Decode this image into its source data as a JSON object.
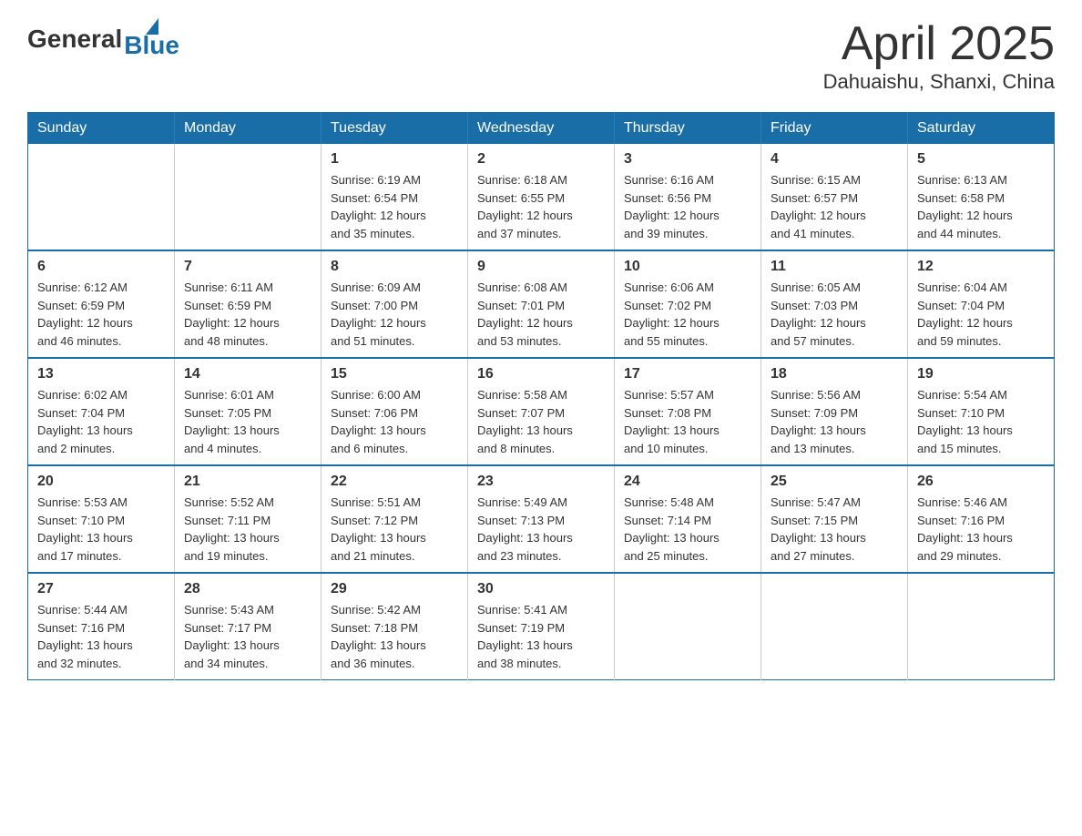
{
  "header": {
    "logo_general": "General",
    "logo_blue": "Blue",
    "month_title": "April 2025",
    "subtitle": "Dahuaishu, Shanxi, China"
  },
  "weekdays": [
    "Sunday",
    "Monday",
    "Tuesday",
    "Wednesday",
    "Thursday",
    "Friday",
    "Saturday"
  ],
  "weeks": [
    [
      {
        "day": "",
        "info": ""
      },
      {
        "day": "",
        "info": ""
      },
      {
        "day": "1",
        "info": "Sunrise: 6:19 AM\nSunset: 6:54 PM\nDaylight: 12 hours\nand 35 minutes."
      },
      {
        "day": "2",
        "info": "Sunrise: 6:18 AM\nSunset: 6:55 PM\nDaylight: 12 hours\nand 37 minutes."
      },
      {
        "day": "3",
        "info": "Sunrise: 6:16 AM\nSunset: 6:56 PM\nDaylight: 12 hours\nand 39 minutes."
      },
      {
        "day": "4",
        "info": "Sunrise: 6:15 AM\nSunset: 6:57 PM\nDaylight: 12 hours\nand 41 minutes."
      },
      {
        "day": "5",
        "info": "Sunrise: 6:13 AM\nSunset: 6:58 PM\nDaylight: 12 hours\nand 44 minutes."
      }
    ],
    [
      {
        "day": "6",
        "info": "Sunrise: 6:12 AM\nSunset: 6:59 PM\nDaylight: 12 hours\nand 46 minutes."
      },
      {
        "day": "7",
        "info": "Sunrise: 6:11 AM\nSunset: 6:59 PM\nDaylight: 12 hours\nand 48 minutes."
      },
      {
        "day": "8",
        "info": "Sunrise: 6:09 AM\nSunset: 7:00 PM\nDaylight: 12 hours\nand 51 minutes."
      },
      {
        "day": "9",
        "info": "Sunrise: 6:08 AM\nSunset: 7:01 PM\nDaylight: 12 hours\nand 53 minutes."
      },
      {
        "day": "10",
        "info": "Sunrise: 6:06 AM\nSunset: 7:02 PM\nDaylight: 12 hours\nand 55 minutes."
      },
      {
        "day": "11",
        "info": "Sunrise: 6:05 AM\nSunset: 7:03 PM\nDaylight: 12 hours\nand 57 minutes."
      },
      {
        "day": "12",
        "info": "Sunrise: 6:04 AM\nSunset: 7:04 PM\nDaylight: 12 hours\nand 59 minutes."
      }
    ],
    [
      {
        "day": "13",
        "info": "Sunrise: 6:02 AM\nSunset: 7:04 PM\nDaylight: 13 hours\nand 2 minutes."
      },
      {
        "day": "14",
        "info": "Sunrise: 6:01 AM\nSunset: 7:05 PM\nDaylight: 13 hours\nand 4 minutes."
      },
      {
        "day": "15",
        "info": "Sunrise: 6:00 AM\nSunset: 7:06 PM\nDaylight: 13 hours\nand 6 minutes."
      },
      {
        "day": "16",
        "info": "Sunrise: 5:58 AM\nSunset: 7:07 PM\nDaylight: 13 hours\nand 8 minutes."
      },
      {
        "day": "17",
        "info": "Sunrise: 5:57 AM\nSunset: 7:08 PM\nDaylight: 13 hours\nand 10 minutes."
      },
      {
        "day": "18",
        "info": "Sunrise: 5:56 AM\nSunset: 7:09 PM\nDaylight: 13 hours\nand 13 minutes."
      },
      {
        "day": "19",
        "info": "Sunrise: 5:54 AM\nSunset: 7:10 PM\nDaylight: 13 hours\nand 15 minutes."
      }
    ],
    [
      {
        "day": "20",
        "info": "Sunrise: 5:53 AM\nSunset: 7:10 PM\nDaylight: 13 hours\nand 17 minutes."
      },
      {
        "day": "21",
        "info": "Sunrise: 5:52 AM\nSunset: 7:11 PM\nDaylight: 13 hours\nand 19 minutes."
      },
      {
        "day": "22",
        "info": "Sunrise: 5:51 AM\nSunset: 7:12 PM\nDaylight: 13 hours\nand 21 minutes."
      },
      {
        "day": "23",
        "info": "Sunrise: 5:49 AM\nSunset: 7:13 PM\nDaylight: 13 hours\nand 23 minutes."
      },
      {
        "day": "24",
        "info": "Sunrise: 5:48 AM\nSunset: 7:14 PM\nDaylight: 13 hours\nand 25 minutes."
      },
      {
        "day": "25",
        "info": "Sunrise: 5:47 AM\nSunset: 7:15 PM\nDaylight: 13 hours\nand 27 minutes."
      },
      {
        "day": "26",
        "info": "Sunrise: 5:46 AM\nSunset: 7:16 PM\nDaylight: 13 hours\nand 29 minutes."
      }
    ],
    [
      {
        "day": "27",
        "info": "Sunrise: 5:44 AM\nSunset: 7:16 PM\nDaylight: 13 hours\nand 32 minutes."
      },
      {
        "day": "28",
        "info": "Sunrise: 5:43 AM\nSunset: 7:17 PM\nDaylight: 13 hours\nand 34 minutes."
      },
      {
        "day": "29",
        "info": "Sunrise: 5:42 AM\nSunset: 7:18 PM\nDaylight: 13 hours\nand 36 minutes."
      },
      {
        "day": "30",
        "info": "Sunrise: 5:41 AM\nSunset: 7:19 PM\nDaylight: 13 hours\nand 38 minutes."
      },
      {
        "day": "",
        "info": ""
      },
      {
        "day": "",
        "info": ""
      },
      {
        "day": "",
        "info": ""
      }
    ]
  ]
}
